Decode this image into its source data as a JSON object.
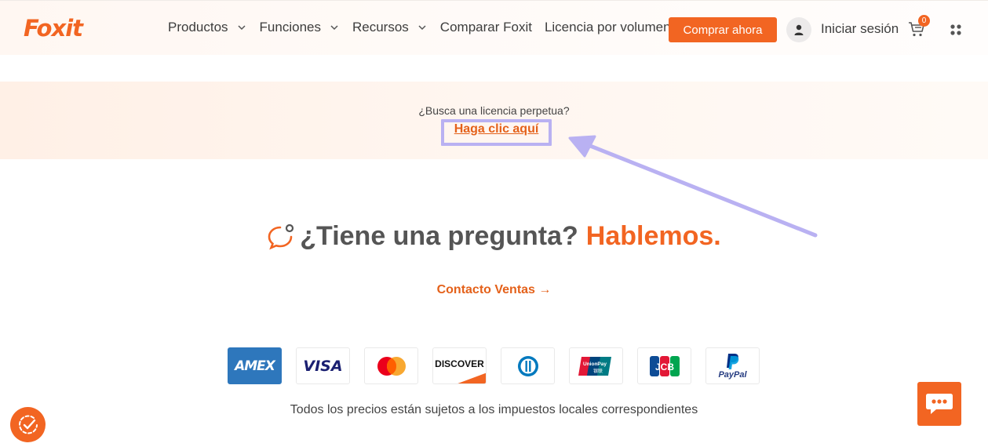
{
  "header": {
    "logo": "Foxit",
    "nav": [
      {
        "label": "Productos",
        "dropdown": true
      },
      {
        "label": "Funciones",
        "dropdown": true
      },
      {
        "label": "Recursos",
        "dropdown": true
      },
      {
        "label": "Comparar Foxit",
        "dropdown": false
      },
      {
        "label": "Licencia por volumen",
        "dropdown": false
      }
    ],
    "buy_label": "Comprar ahora",
    "signin_label": "Iniciar sesión",
    "cart_count": "0",
    "user_icon": "user-icon",
    "cart_icon": "cart-icon",
    "apps_icon": "apps-grid-icon"
  },
  "banner": {
    "question": "¿Busca una licencia perpetua?",
    "link": "Haga clic aquí"
  },
  "cta": {
    "title_main": "¿Tiene una pregunta?",
    "title_accent": "Hablemos.",
    "contact_label": "Contacto Ventas",
    "contact_arrow": "→"
  },
  "payments": {
    "methods": [
      "AMEX",
      "VISA",
      "Mastercard",
      "DISCOVER",
      "Diners Club",
      "UnionPay",
      "JCB",
      "PayPal"
    ],
    "union_pay_sub": "银联",
    "note": "Todos los precios están sujetos a los impuestos locales correspondientes"
  },
  "colors": {
    "brand": "#f26522",
    "highlight": "#b9b1f2",
    "text": "#3d3d3d"
  }
}
